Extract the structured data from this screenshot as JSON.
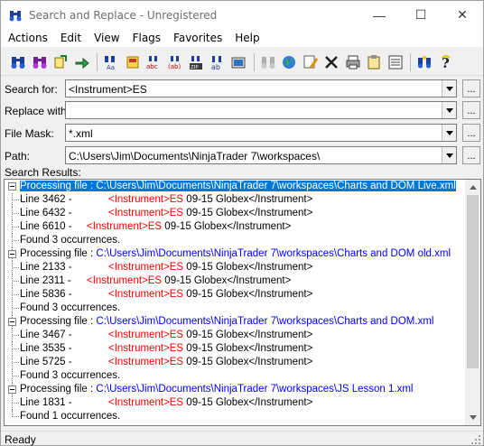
{
  "window": {
    "title": "Search and Replace - Unregistered",
    "icon": "binoculars-icon",
    "controls": {
      "minimize": "—",
      "maximize": "☐",
      "close": "✕"
    }
  },
  "menu": [
    "Actions",
    "Edit",
    "View",
    "Flags",
    "Favorites",
    "Help"
  ],
  "toolbar": [
    "search-icon",
    "search-files-icon",
    "replace-icon",
    "replace-all-icon",
    "sep",
    "find-in-files-icon",
    "replace-in-files-icon",
    "replace-abc-icon",
    "replace-ab-icon",
    "zip-search-icon",
    "replace-regex-icon",
    "explorer-icon",
    "sep",
    "disabled-search-icon",
    "globe-icon",
    "edit-pencil-icon",
    "delete-icon",
    "print-icon",
    "clipboard-icon",
    "list-icon",
    "sep",
    "search-favorites-icon",
    "help-icon"
  ],
  "form": {
    "search_for": {
      "label": "Search for:",
      "value": "<Instrument>ES"
    },
    "replace_with": {
      "label": "Replace with:",
      "value": ""
    },
    "file_mask": {
      "label": "File Mask:",
      "value": "*.xml"
    },
    "path": {
      "label": "Path:",
      "value": "C:\\Users\\Jim\\Documents\\NinjaTrader 7\\workspaces\\"
    },
    "browse_label": "..."
  },
  "results": {
    "label": "Search Results:",
    "processing_prefix": "Processing file :",
    "groups": [
      {
        "file": "C:\\Users\\Jim\\Documents\\NinjaTrader 7\\workspaces\\Charts and DOM Live.xml",
        "selected": true,
        "lines": [
          {
            "line": "Line 3462 -",
            "match": "<Instrument>ES",
            "rest": " 09-15 Globex</Instrument>",
            "indent": true
          },
          {
            "line": "Line 6432 -",
            "match": "<Instrument>ES",
            "rest": " 09-15 Globex</Instrument>",
            "indent": true
          },
          {
            "line": "Line 6610 -",
            "match": "<Instrument>ES",
            "rest": " 09-15 Globex</Instrument>",
            "indent": false
          }
        ],
        "summary": "Found 3 occurrences."
      },
      {
        "file": "C:\\Users\\Jim\\Documents\\NinjaTrader 7\\workspaces\\Charts and DOM old.xml",
        "selected": false,
        "lines": [
          {
            "line": "Line 2133 -",
            "match": "<Instrument>ES",
            "rest": " 09-15 Globex</Instrument>",
            "indent": true
          },
          {
            "line": "Line 2311 -",
            "match": "<Instrument>ES",
            "rest": " 09-15 Globex</Instrument>",
            "indent": false
          },
          {
            "line": "Line 5836 -",
            "match": "<Instrument>ES",
            "rest": " 09-15 Globex</Instrument>",
            "indent": true
          }
        ],
        "summary": "Found 3 occurrences."
      },
      {
        "file": "C:\\Users\\Jim\\Documents\\NinjaTrader 7\\workspaces\\Charts and DOM.xml",
        "selected": false,
        "lines": [
          {
            "line": "Line 3467 -",
            "match": "<Instrument>ES",
            "rest": " 09-15 Globex</Instrument>",
            "indent": true
          },
          {
            "line": "Line 3535 -",
            "match": "<Instrument>ES",
            "rest": " 09-15 Globex</Instrument>",
            "indent": true
          },
          {
            "line": "Line 5725 -",
            "match": "<Instrument>ES",
            "rest": " 09-15 Globex</Instrument>",
            "indent": true
          }
        ],
        "summary": "Found 3 occurrences."
      },
      {
        "file": "C:\\Users\\Jim\\Documents\\NinjaTrader 7\\workspaces\\JS Lesson 1.xml",
        "selected": false,
        "lines": [
          {
            "line": "Line 1831 -",
            "match": "<Instrument>ES",
            "rest": " 09-15 Globex</Instrument>",
            "indent": true
          }
        ],
        "summary": "Found 1 occurrences."
      }
    ]
  },
  "status": {
    "text": "Ready"
  },
  "colors": {
    "file_path": "#0000ff",
    "match": "#ff0000",
    "selection": "#0078d7"
  }
}
